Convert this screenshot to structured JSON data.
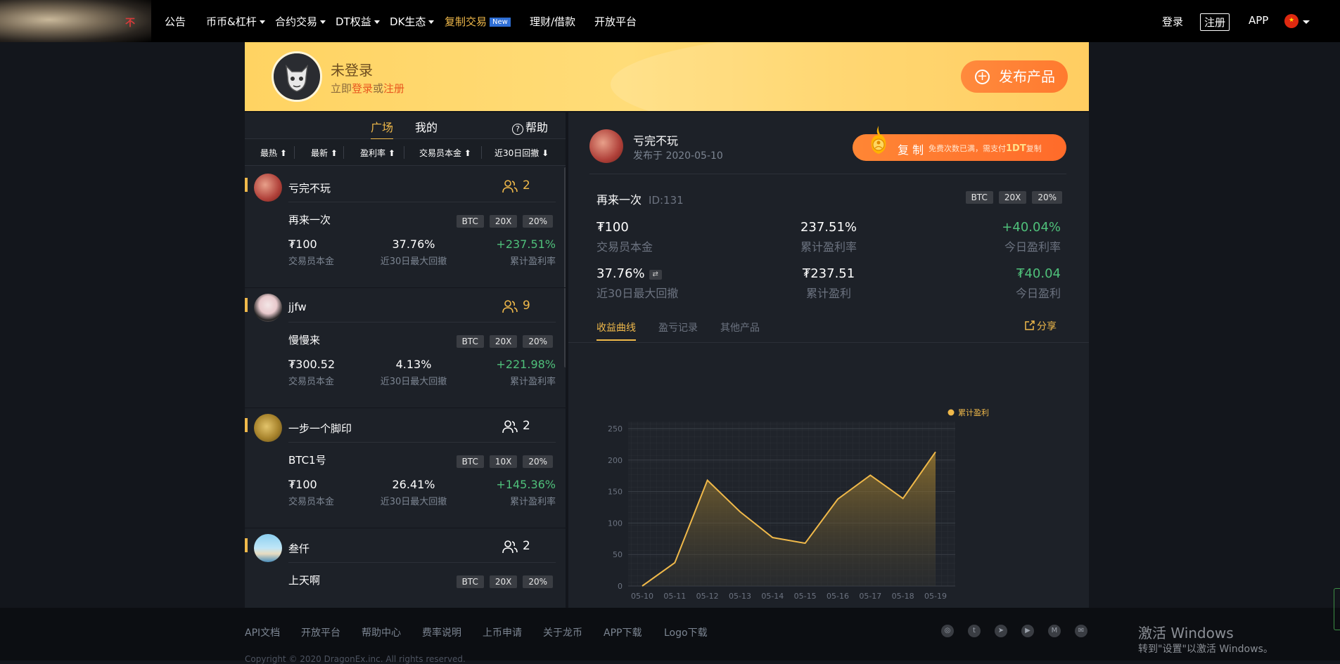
{
  "nav": {
    "items": [
      {
        "label": "公告",
        "caret": false
      },
      {
        "label": "币币&杠杆",
        "caret": true
      },
      {
        "label": "合约交易",
        "caret": true
      },
      {
        "label": "DT权益",
        "caret": true
      },
      {
        "label": "DK生态",
        "caret": true
      },
      {
        "label": "复制交易",
        "badge": "New"
      },
      {
        "label": "理财/借款"
      },
      {
        "label": "开放平台"
      }
    ],
    "login": "登录",
    "register": "注册",
    "app": "APP",
    "logo_mark": "不"
  },
  "banner": {
    "title": "未登录",
    "sub_prefix": "立即",
    "login_link": "登录",
    "or": "或",
    "register_link": "注册",
    "publish": "发布产品"
  },
  "left": {
    "tabs": [
      "广场",
      "我的"
    ],
    "help": "帮助",
    "sorts": [
      "最热 ⬆",
      "最新 ⬆",
      "盈利率 ⬆",
      "交易员本金 ⬆",
      "近30日回撤 ⬇"
    ],
    "cards": [
      {
        "name": "亏完不玩",
        "followers": "2",
        "product": "再来一次",
        "tags": [
          "BTC",
          "20X",
          "20%"
        ],
        "capital": "₮100",
        "capital_label": "交易员本金",
        "drawdown": "37.76%",
        "drawdown_label": "近30日最大回撤",
        "profit": "+237.51%",
        "profit_label": "累计盈利率"
      },
      {
        "name": "jjfw",
        "followers": "9",
        "product": "慢慢来",
        "tags": [
          "BTC",
          "20X",
          "20%"
        ],
        "capital": "₮300.52",
        "capital_label": "交易员本金",
        "drawdown": "4.13%",
        "drawdown_label": "近30日最大回撤",
        "profit": "+221.98%",
        "profit_label": "累计盈利率"
      },
      {
        "name": "一步一个脚印",
        "followers": "2",
        "product": "BTC1号",
        "tags": [
          "BTC",
          "10X",
          "20%"
        ],
        "capital": "₮100",
        "capital_label": "交易员本金",
        "drawdown": "26.41%",
        "drawdown_label": "近30日最大回撤",
        "profit": "+145.36%",
        "profit_label": "累计盈利率"
      },
      {
        "name": "叁仟",
        "followers": "2",
        "product": "上天啊",
        "tags": [
          "BTC",
          "20X",
          "20%"
        ]
      }
    ]
  },
  "detail": {
    "name": "亏完不玩",
    "date": "发布于 2020-05-10",
    "copy": "复 制",
    "copy_note_prefix": "免费次数已满，需支付",
    "copy_note_amount": "1DT",
    "copy_note_suffix": "复制",
    "product": "再来一次",
    "product_id": "ID:131",
    "tags": [
      "BTC",
      "20X",
      "20%"
    ],
    "stats": [
      {
        "value": "₮100",
        "label": "交易员本金"
      },
      {
        "value": "237.51%",
        "label": "累计盈利率"
      },
      {
        "value": "+40.04%",
        "label": "今日盈利率"
      },
      {
        "value": "37.76%",
        "label": "近30日最大回撤"
      },
      {
        "value": "₮237.51",
        "label": "累计盈利"
      },
      {
        "value": "₮40.04",
        "label": "今日盈利"
      }
    ],
    "swap_icon": "⇄",
    "chart_tabs": [
      "收益曲线",
      "盈亏记录",
      "其他产品"
    ],
    "share": "分享"
  },
  "chart_data": {
    "type": "area",
    "categories": [
      "05-10",
      "05-11",
      "05-12",
      "05-13",
      "05-14",
      "05-15",
      "05-16",
      "05-17",
      "05-18",
      "05-19"
    ],
    "series": [
      {
        "name": "累计盈利",
        "values": [
          0,
          37,
          168,
          118,
          77,
          68,
          138,
          176,
          139,
          213
        ]
      }
    ],
    "ylim": [
      0,
      250
    ],
    "yticks": [
      0,
      50,
      100,
      150,
      200,
      250
    ],
    "legend": "top-right",
    "color": "#f0b94a"
  },
  "footer": {
    "links": [
      "API文档",
      "开放平台",
      "帮助中心",
      "费率说明",
      "上币申请",
      "关于龙币",
      "APP下载",
      "Logo下载"
    ],
    "social": [
      "wechat-icon",
      "twitter-icon",
      "telegram-icon",
      "youtube-icon",
      "medium-icon",
      "mail-icon"
    ],
    "copyright": "Copyright © 2020 DragonEx.inc. All rights reserved."
  },
  "windows": {
    "line1": "激活 Windows",
    "line2": "转到\"设置\"以激活 Windows。"
  }
}
